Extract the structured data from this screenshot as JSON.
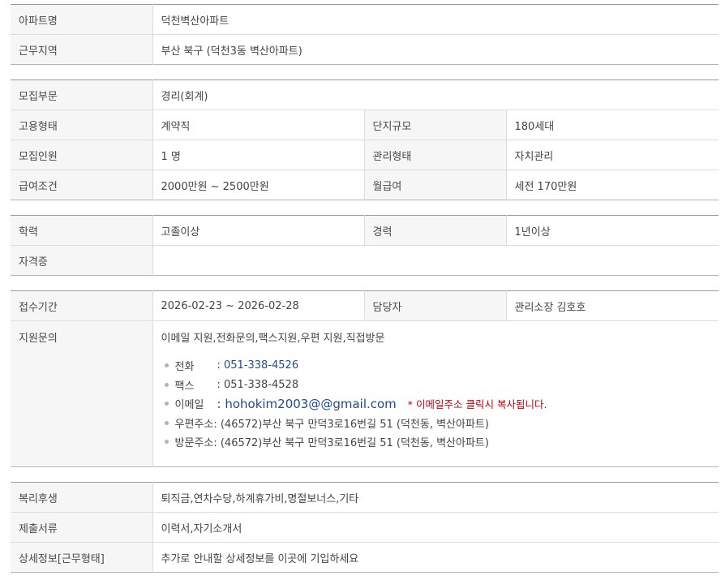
{
  "apartment": {
    "name_label": "아파트명",
    "name_value": "덕천벽산아파트",
    "region_label": "근무지역",
    "region_value": "부산 북구 (덕천3동 벽산아파트)"
  },
  "recruit": {
    "dept_label": "모집부문",
    "dept_value": "경리(회계)",
    "emp_type_label": "고용형태",
    "emp_type_value": "계약직",
    "complex_size_label": "단지규모",
    "complex_size_value": "180세대",
    "headcount_label": "모집인원",
    "headcount_value": "1 명",
    "mgmt_type_label": "관리형태",
    "mgmt_type_value": "자치관리",
    "salary_label": "급여조건",
    "salary_value": "2000만원 ~ 2500만원",
    "monthly_label": "월급여",
    "monthly_value": "세전 170만원"
  },
  "qualification": {
    "edu_label": "학력",
    "edu_value": "고졸이상",
    "career_label": "경력",
    "career_value": "1년이상",
    "license_label": "자격증",
    "license_value": ""
  },
  "application": {
    "period_label": "접수기간",
    "period_value": "2026-02-23 ~ 2026-02-28",
    "manager_label": "담당자",
    "manager_value": "관리소장 김호호",
    "inquiry_label": "지원문의",
    "inquiry_methods": "이메일 지원,전화문의,팩스지원,우편 지원,직접방문",
    "phone_label": "전화",
    "phone_value": ": 051-338-4526",
    "fax_label": "팩스",
    "fax_value": ": 051-338-4528",
    "email_label": "이메일",
    "email_value": ": hohokim2003@@gmail.com",
    "email_note": "* 이메일주소 클릭시 복사됩니다.",
    "mail_label": "우편주소",
    "mail_value": ": (46572)부산 북구 만덕3로16번길 51 (덕천동, 벽산아파트)",
    "visit_label": "방문주소",
    "visit_value": ": (46572)부산 북구 만덕3로16번길 51 (덕천동, 벽산아파트)"
  },
  "extra": {
    "welfare_label": "복리후생",
    "welfare_value": "퇴직금,연차수당,하계휴가비,명절보너스,기타",
    "docs_label": "제출서류",
    "docs_value": "이력서,자기소개서",
    "detail_label": "상세정보[근무형태]",
    "detail_value": "추가로 안내할 상세정보를 이곳에 기입하세요"
  }
}
